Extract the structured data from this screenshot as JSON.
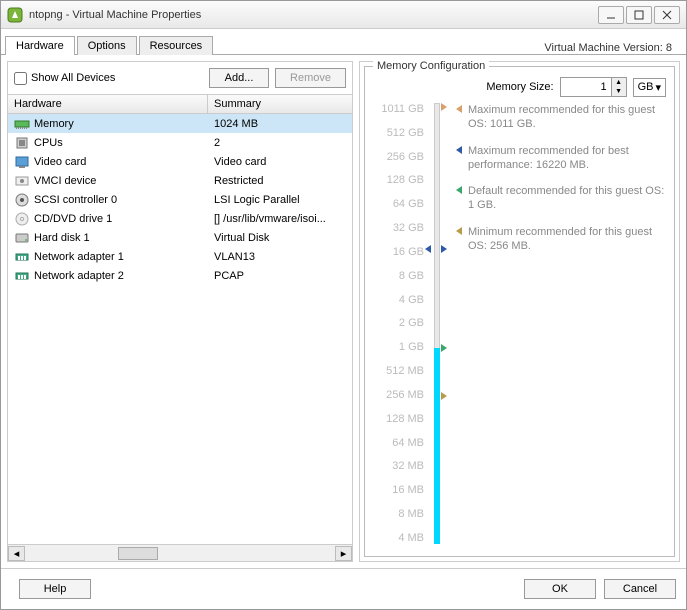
{
  "window": {
    "title": "ntopng - Virtual Machine Properties",
    "version": "Virtual Machine Version: 8"
  },
  "tabs": [
    "Hardware",
    "Options",
    "Resources"
  ],
  "activeTab": 0,
  "toolbar": {
    "showAll": "Show All Devices",
    "add": "Add...",
    "remove": "Remove"
  },
  "columns": {
    "hw": "Hardware",
    "sum": "Summary"
  },
  "hardware": [
    {
      "icon": "memory",
      "name": "Memory",
      "summary": "1024 MB",
      "selected": true
    },
    {
      "icon": "cpu",
      "name": "CPUs",
      "summary": "2"
    },
    {
      "icon": "video",
      "name": "Video card",
      "summary": "Video card"
    },
    {
      "icon": "vmci",
      "name": "VMCI device",
      "summary": "Restricted"
    },
    {
      "icon": "scsi",
      "name": "SCSI controller 0",
      "summary": "LSI Logic Parallel"
    },
    {
      "icon": "cd",
      "name": "CD/DVD drive 1",
      "summary": "[] /usr/lib/vmware/isoi..."
    },
    {
      "icon": "disk",
      "name": "Hard disk 1",
      "summary": "Virtual Disk"
    },
    {
      "icon": "nic",
      "name": "Network adapter 1",
      "summary": "VLAN13"
    },
    {
      "icon": "nic",
      "name": "Network adapter 2",
      "summary": "PCAP"
    }
  ],
  "memcfg": {
    "legend": "Memory Configuration",
    "sizeLabel": "Memory Size:",
    "sizeValue": "1",
    "unit": "GB",
    "scale": [
      "1011 GB",
      "512 GB",
      "256 GB",
      "128 GB",
      "64 GB",
      "32 GB",
      "16 GB",
      "8 GB",
      "4 GB",
      "2 GB",
      "1 GB",
      "512 MB",
      "256 MB",
      "128 MB",
      "64 MB",
      "32 MB",
      "16 MB",
      "8 MB",
      "4 MB"
    ],
    "fillTopIndex": 10,
    "notes": [
      {
        "color": "#d9a06b",
        "text": "Maximum recommended for this guest OS: 1011 GB."
      },
      {
        "color": "#2e5aa8",
        "text": "Maximum recommended for best performance: 16220 MB."
      },
      {
        "color": "#3aa86b",
        "text": "Default recommended for this guest OS: 1 GB."
      },
      {
        "color": "#b89b4a",
        "text": "Minimum recommended for this guest OS: 256 MB."
      }
    ],
    "markers": [
      {
        "color": "#d9a06b",
        "topPct": 1,
        "side": "r"
      },
      {
        "color": "#2e5aa8",
        "topPct": 33,
        "side": "r"
      },
      {
        "color": "#3aa86b",
        "topPct": 55.5,
        "side": "r"
      },
      {
        "color": "#b89b4a",
        "topPct": 66.5,
        "side": "r"
      },
      {
        "color": "#2e5aa8",
        "topPct": 33,
        "side": "l"
      }
    ]
  },
  "footer": {
    "help": "Help",
    "ok": "OK",
    "cancel": "Cancel"
  },
  "iconSvg": {
    "memory": "<svg width='16' height='16'><rect x='1' y='5' width='14' height='6' fill='#5bb85b' stroke='#2e7d2e'/><rect x='2' y='11' width='1' height='2' fill='#888'/><rect x='4' y='11' width='1' height='2' fill='#888'/><rect x='6' y='11' width='1' height='2' fill='#888'/><rect x='8' y='11' width='1' height='2' fill='#888'/><rect x='10' y='11' width='1' height='2' fill='#888'/><rect x='12' y='11' width='1' height='2' fill='#888'/></svg>",
    "cpu": "<svg width='16' height='16'><rect x='3' y='3' width='10' height='10' fill='#d0d0d0' stroke='#777'/><rect x='5' y='5' width='6' height='6' fill='#888'/></svg>",
    "video": "<svg width='16' height='16'><rect x='2' y='3' width='12' height='9' fill='#5aa0d6' stroke='#2d6aa0'/><rect x='5' y='12' width='6' height='2' fill='#888'/></svg>",
    "vmci": "<svg width='16' height='16'><rect x='2' y='4' width='12' height='8' fill='#eee' stroke='#999'/><circle cx='8' cy='8' r='2' fill='#888'/></svg>",
    "scsi": "<svg width='16' height='16'><circle cx='8' cy='8' r='6' fill='#ddd' stroke='#777'/><circle cx='8' cy='8' r='2' fill='#555'/></svg>",
    "cd": "<svg width='16' height='16'><circle cx='8' cy='8' r='6' fill='#eee' stroke='#aaa'/><circle cx='8' cy='8' r='1.5' fill='#fff' stroke='#aaa'/></svg>",
    "disk": "<svg width='16' height='16'><rect x='2' y='4' width='12' height='8' rx='1' fill='#ccc' stroke='#777'/><circle cx='12' cy='10' r='1' fill='#5b5'/></svg>",
    "nic": "<svg width='16' height='16'><rect x='2' y='5' width='12' height='6' fill='#4a8' stroke='#275'/><rect x='4' y='7' width='2' height='4' fill='#fff'/><rect x='7' y='7' width='2' height='4' fill='#fff'/><rect x='10' y='7' width='2' height='4' fill='#fff'/></svg>",
    "app": "<svg width='16' height='16'><rect x='1' y='1' width='14' height='14' rx='3' fill='#7db53a' stroke='#4a7a1e'/><path d='M5 11 L8 4 L11 11 Z' fill='#fff'/></svg>"
  }
}
